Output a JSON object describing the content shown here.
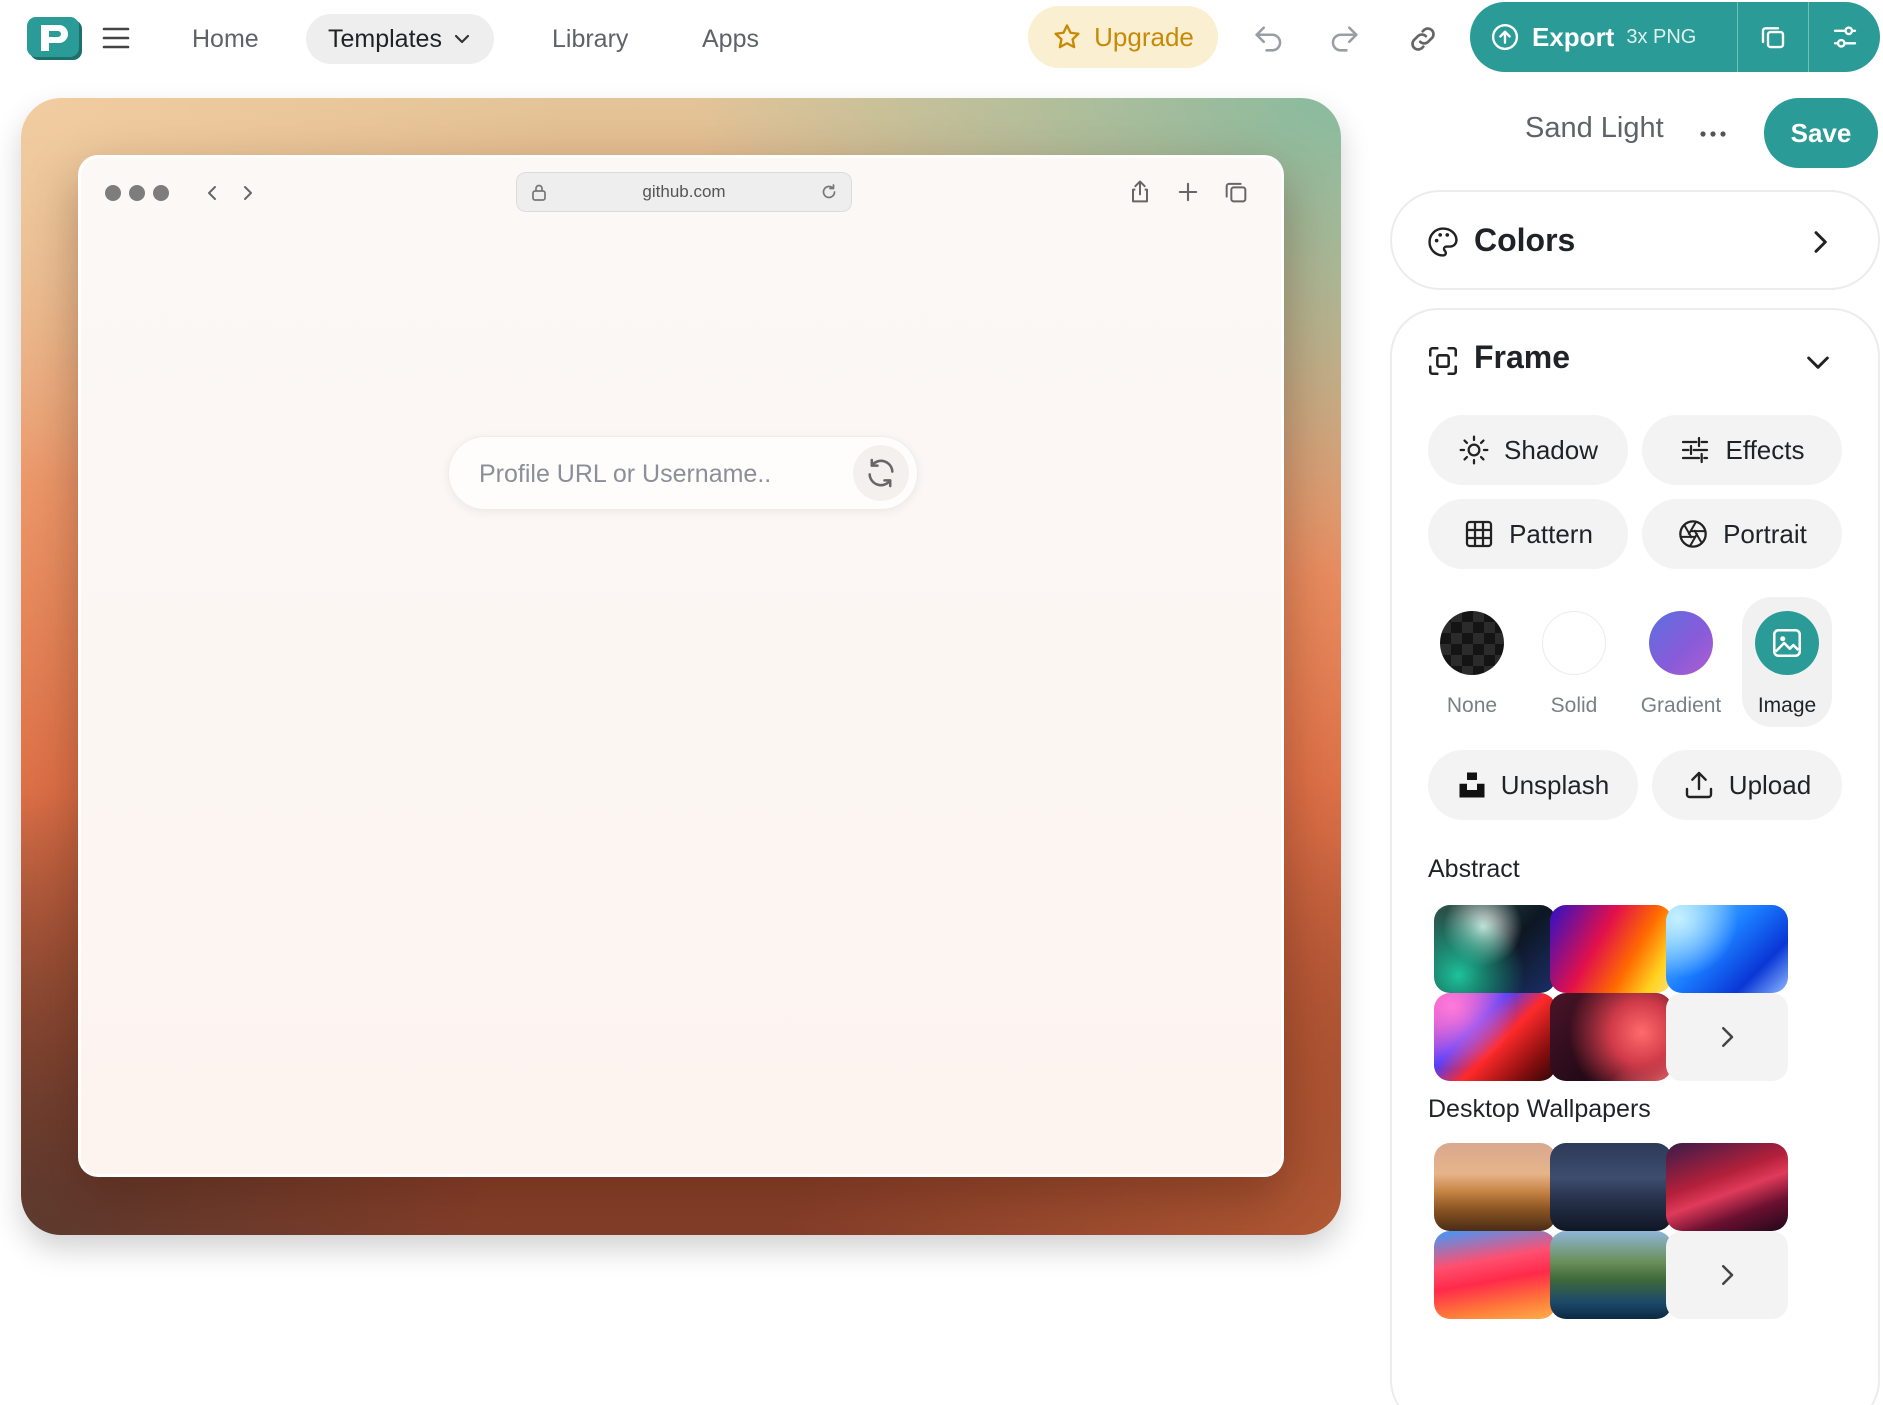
{
  "nav": {
    "home": "Home",
    "templates": "Templates",
    "library": "Library",
    "apps": "Apps"
  },
  "toolbar": {
    "upgrade": "Upgrade",
    "export_label": "Export",
    "export_sub": "3x PNG"
  },
  "browser": {
    "url": "github.com",
    "profile_placeholder": "Profile URL or Username.."
  },
  "panel": {
    "theme_name": "Sand Light",
    "save": "Save",
    "colors_title": "Colors",
    "frame_title": "Frame",
    "options": {
      "shadow": "Shadow",
      "effects": "Effects",
      "pattern": "Pattern",
      "portrait": "Portrait"
    },
    "backgrounds": {
      "none": "None",
      "solid": "Solid",
      "gradient": "Gradient",
      "image": "Image",
      "selected": "Image"
    },
    "sources": {
      "unsplash": "Unsplash",
      "upload": "Upload"
    },
    "abstract_label": "Abstract",
    "wallpapers_label": "Desktop Wallpapers"
  },
  "colors": {
    "accent": "#2a9b96",
    "upgrade_bg": "#fbefd2",
    "upgrade_text": "#c78a08"
  }
}
